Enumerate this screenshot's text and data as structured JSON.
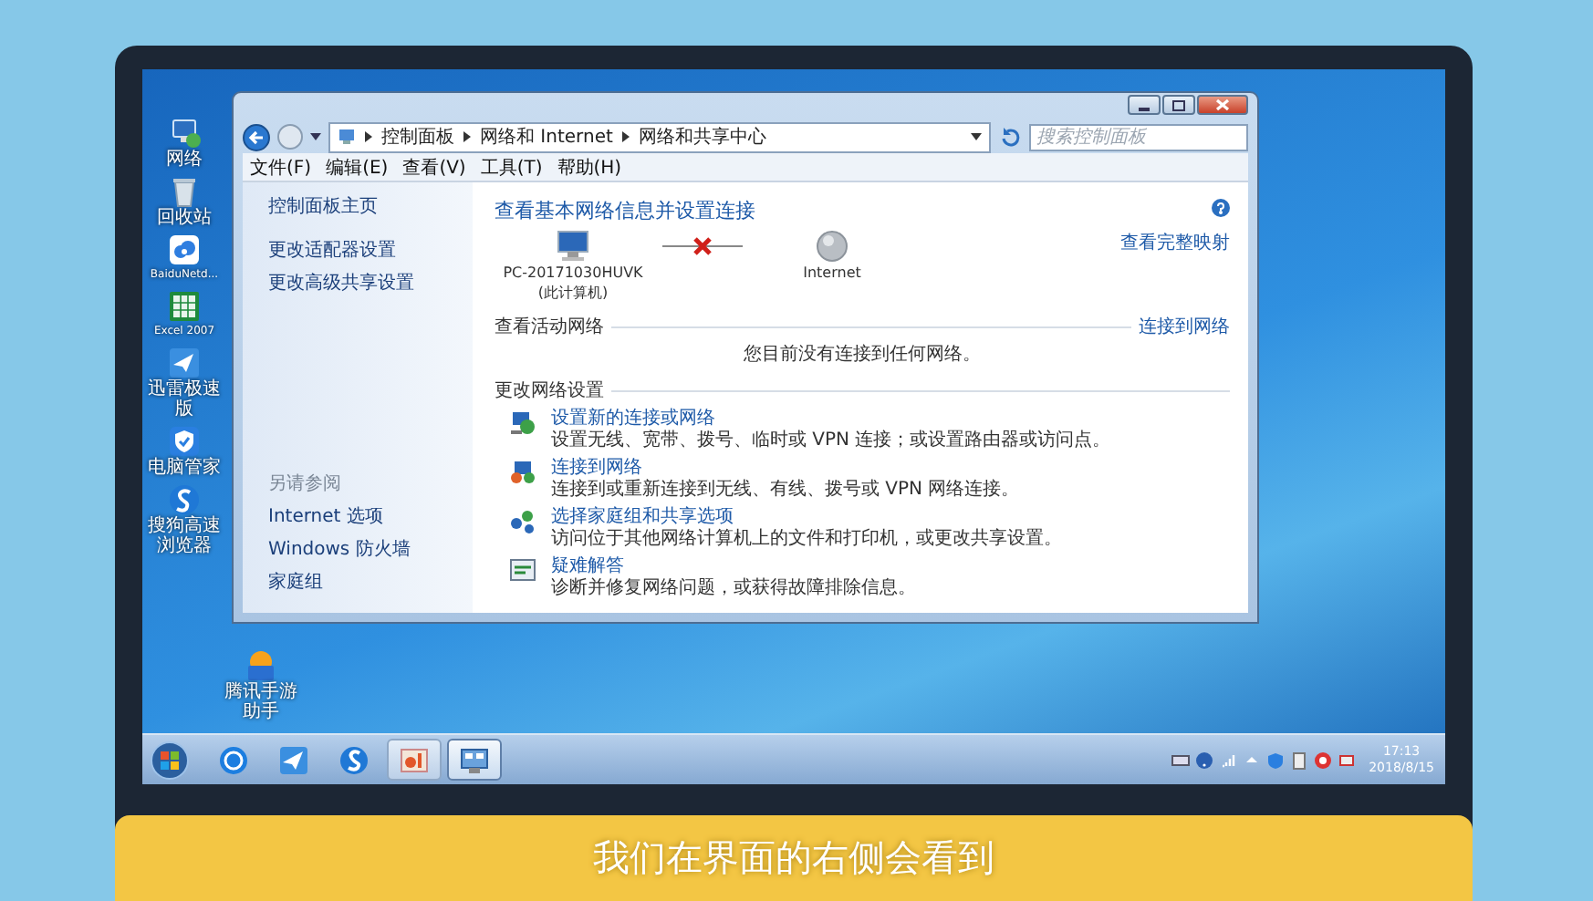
{
  "desktop_icons": [
    {
      "label": "网络",
      "kind": "network"
    },
    {
      "label": "回收站",
      "kind": "recycle"
    },
    {
      "label": "BaiduNetd...",
      "kind": "cloud"
    },
    {
      "label": "Excel 2007",
      "kind": "sheet"
    },
    {
      "label": "迅雷极速版",
      "kind": "bird"
    },
    {
      "label": "电脑管家",
      "kind": "shield"
    },
    {
      "label": "搜狗高速浏览器",
      "kind": "browser"
    },
    {
      "label": "腾讯手游助手",
      "kind": "game"
    }
  ],
  "window": {
    "breadcrumbs": [
      "控制面板",
      "网络和 Internet",
      "网络和共享中心"
    ],
    "search": {
      "placeholder": "搜索控制面板"
    },
    "menu": [
      "文件(F)",
      "编辑(E)",
      "查看(V)",
      "工具(T)",
      "帮助(H)"
    ],
    "sidebar": {
      "items": [
        "控制面板主页",
        "更改适配器设置",
        "更改高级共享设置"
      ],
      "see_also_heading": "另请参阅",
      "see_also": [
        "Internet 选项",
        "Windows 防火墙",
        "家庭组"
      ]
    },
    "title": "查看基本网络信息并设置连接",
    "map": {
      "computer": "PC-20171030HUVK",
      "computer_note": "(此计算机)",
      "internet": "Internet",
      "connected": false,
      "full_map_link": "查看完整映射"
    },
    "active_networks": {
      "heading": "查看活动网络",
      "link": "连接到网络",
      "message": "您目前没有连接到任何网络。"
    },
    "change_settings": {
      "heading": "更改网络设置",
      "tasks": [
        {
          "kind": "new-connection",
          "title": "设置新的连接或网络",
          "description": "设置无线、宽带、拨号、临时或 VPN 连接；或设置路由器或访问点。"
        },
        {
          "kind": "connect",
          "title": "连接到网络",
          "description": "连接到或重新连接到无线、有线、拨号或 VPN 网络连接。"
        },
        {
          "kind": "homegroup",
          "title": "选择家庭组和共享选项",
          "description": "访问位于其他网络计算机上的文件和打印机，或更改共享设置。"
        },
        {
          "kind": "troubleshoot",
          "title": "疑难解答",
          "description": "诊断并修复网络问题，或获得故障排除信息。"
        }
      ]
    }
  },
  "taskbar": {
    "items": [
      {
        "kind": "k",
        "running": false,
        "selected": false
      },
      {
        "kind": "bird",
        "running": false,
        "selected": false
      },
      {
        "kind": "s",
        "running": false,
        "selected": false
      },
      {
        "kind": "paint",
        "running": true,
        "selected": false
      },
      {
        "kind": "network",
        "running": true,
        "selected": true
      }
    ],
    "time": "17:13",
    "date": "2018/8/15"
  },
  "caption": "我们在界面的右侧会看到"
}
